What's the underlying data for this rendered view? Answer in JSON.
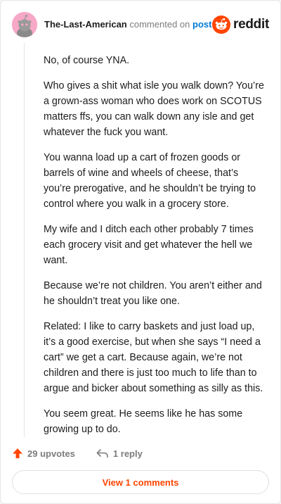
{
  "header": {
    "username": "The-Last-American",
    "action_text": "commented on",
    "post_link": "post",
    "brand_word": "reddit"
  },
  "comment": {
    "paragraphs": [
      "No, of course YNA.",
      "Who gives a shit what isle you walk down? You’re a grown-ass woman who does work on SCOTUS matters ffs, you can walk down any isle and get whatever the fuck you want.",
      "You wanna load up a cart of frozen goods or barrels of wine and wheels of cheese, that’s you’re prerogative, and he shouldn’t be trying to control where you walk in a grocery store.",
      "My wife and I ditch each other probably 7 times each grocery visit and get whatever the hell we want.",
      "Because we’re not children. You aren’t either and he shouldn’t treat you like one.",
      "Related: I like to carry baskets and just load up, it’s a good exercise, but when she says “I need a cart” we get a cart. Because again, we’re not children and there is just too much to life than to argue and bicker about something as silly as this.",
      "You seem great. He seems like he has some growing up to do."
    ]
  },
  "footer": {
    "upvotes_label": "29 upvotes",
    "reply_label": "1 reply",
    "view_comments_label": "View 1 comments"
  },
  "icons": {
    "upvote": "upvote-arrow-icon",
    "reply": "reply-arrow-icon",
    "brand": "reddit-snoo-icon",
    "avatar": "snoo-avatar-icon"
  },
  "colors": {
    "accent": "#ff4500",
    "link": "#0079d3",
    "avatar_bg": "#f7a8c6",
    "muted": "#7c7c7c"
  }
}
